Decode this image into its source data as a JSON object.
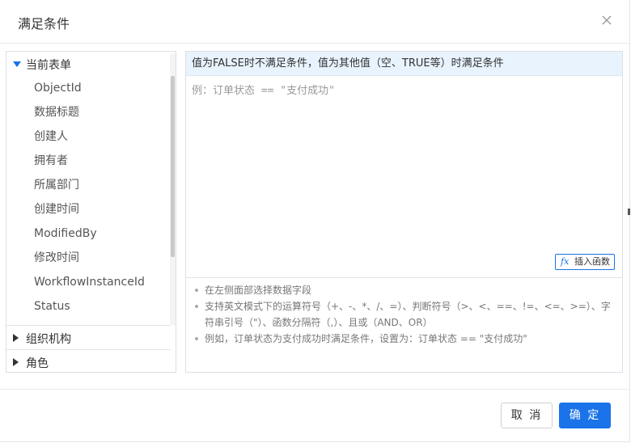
{
  "dialog": {
    "title": "满足条件"
  },
  "left_panel": {
    "groups": [
      {
        "label": "当前表单",
        "expanded": true,
        "fields": [
          "ObjectId",
          "数据标题",
          "创建人",
          "拥有者",
          "所属部门",
          "创建时间",
          "ModifiedBy",
          "修改时间",
          "WorkflowInstanceId",
          "Status"
        ]
      },
      {
        "label": "组织机构",
        "expanded": false
      },
      {
        "label": "角色",
        "expanded": false
      }
    ]
  },
  "editor": {
    "hint": "值为FALSE时不满足条件，值为其他值（空、TRUE等）时满足条件",
    "placeholder": "例：订单状态 == \"支付成功\"",
    "value": "",
    "insert_function_label": "插入函数",
    "insert_function_icon_text": "fx"
  },
  "notes": [
    "在左侧面部选择数据字段",
    "支持英文模式下的运算符号（+、-、*、/、=）、判断符号（>、<、==、!=、<=、>=）、字符串引号（\"）、函数分隔符（,）、且或（AND、OR）",
    "例如，订单状态为支付成功时满足条件，设置为：订单状态 == \"支付成功\""
  ],
  "footer": {
    "cancel_label": "取 消",
    "ok_label": "确 定"
  },
  "colors": {
    "accent": "#1a73e8",
    "hint_background": "#e8f3fd"
  }
}
